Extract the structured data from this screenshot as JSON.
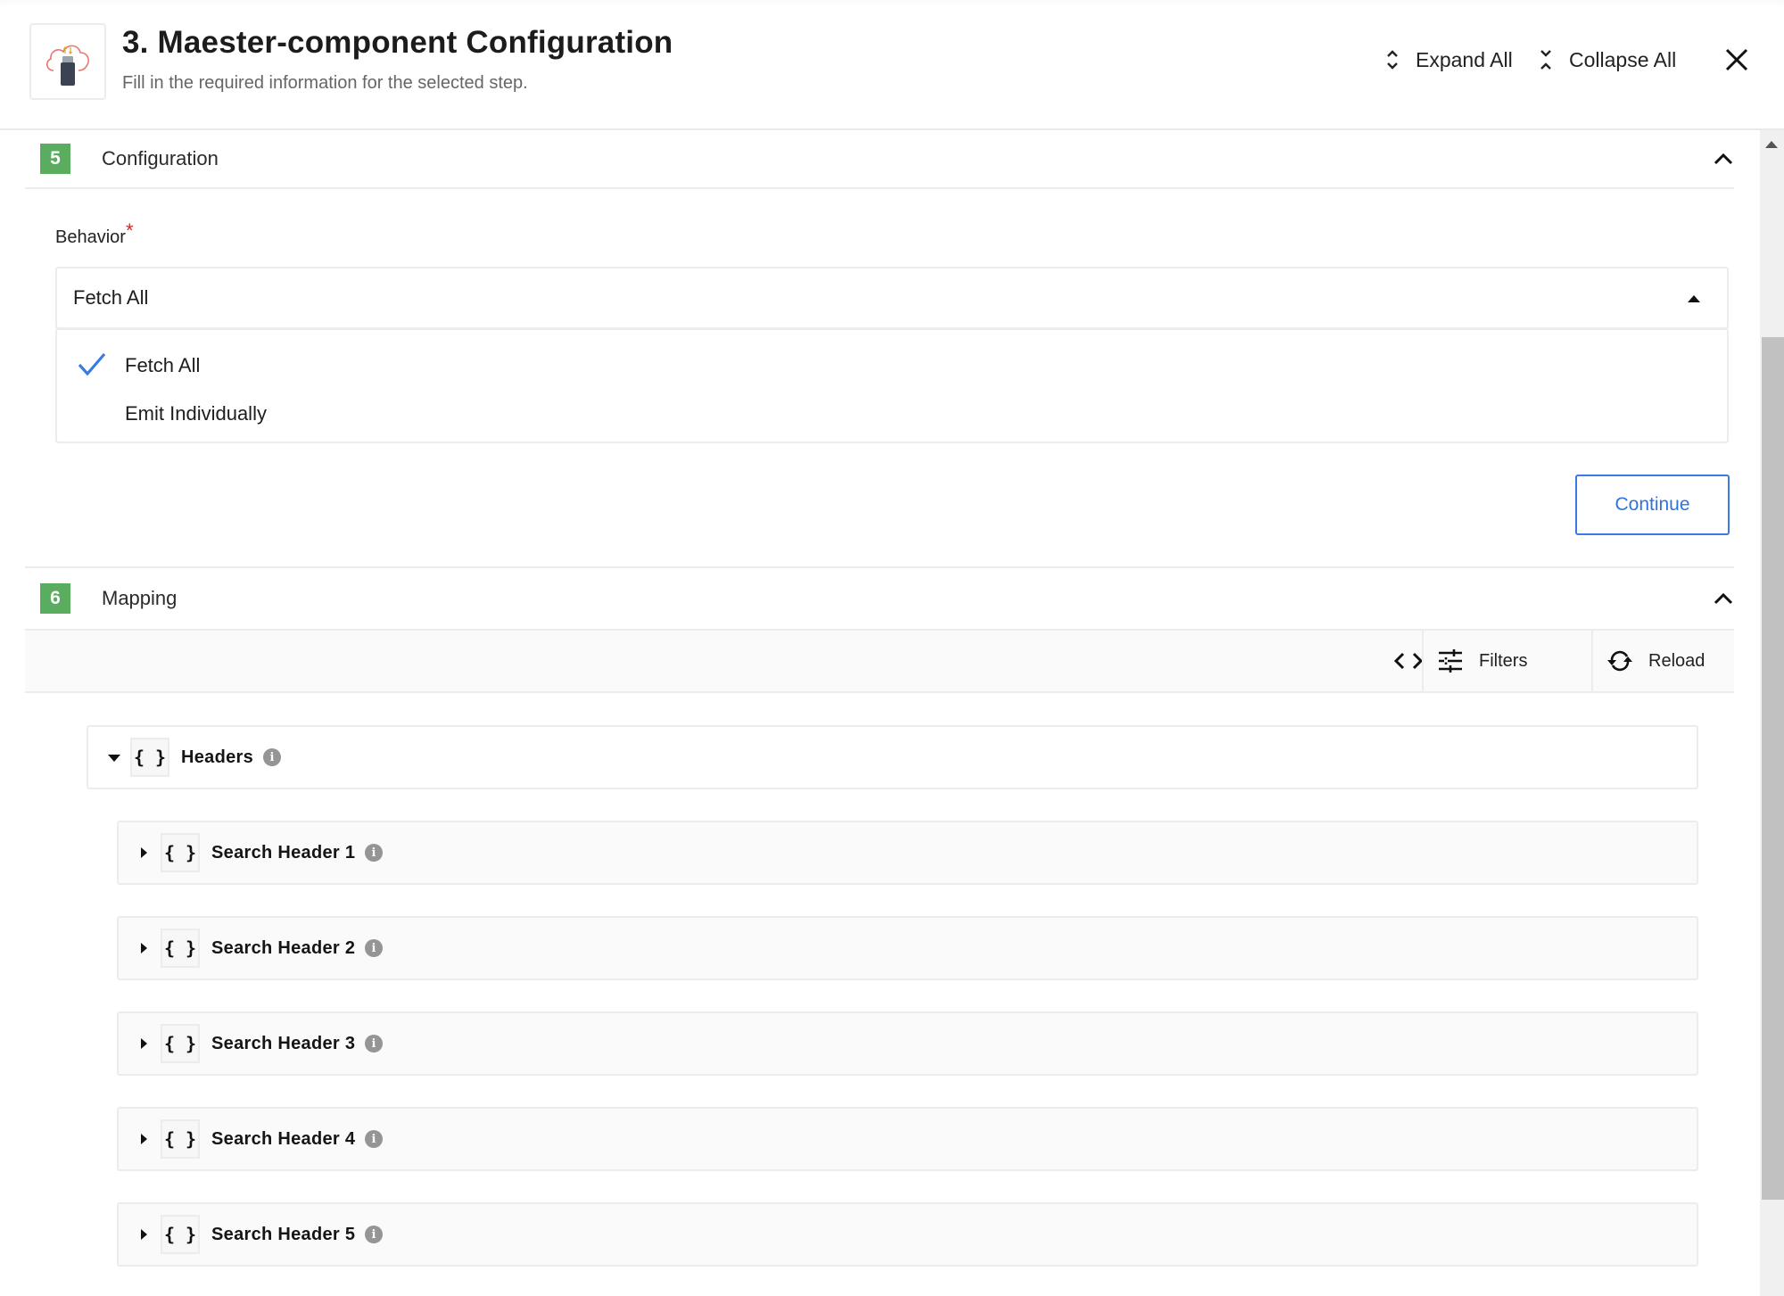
{
  "header": {
    "title": "3. Maester-component Configuration",
    "subtitle": "Fill in the required information for the selected step.",
    "logo_icon": "cloud-usb-icon",
    "expand_all_label": "Expand All",
    "collapse_all_label": "Collapse All",
    "close_icon": "close-icon"
  },
  "sections": [
    {
      "number": "5",
      "title": "Configuration",
      "expanded": true,
      "field": {
        "label": "Behavior",
        "required_mark": "*",
        "selected_value": "Fetch All",
        "dropdown_open": true,
        "options": [
          {
            "label": "Fetch All",
            "selected": true
          },
          {
            "label": "Emit Individually",
            "selected": false
          }
        ]
      },
      "continue_label": "Continue"
    },
    {
      "number": "6",
      "title": "Mapping",
      "expanded": true,
      "toolbar": {
        "code_view_icon": "code-brackets-icon",
        "filters_label": "Filters",
        "reload_label": "Reload"
      },
      "tree": {
        "root": {
          "label": "Headers",
          "type_icon": "{ }",
          "expanded": true
        },
        "children": [
          {
            "label": "Search Header 1",
            "type_icon": "{ }",
            "expanded": false
          },
          {
            "label": "Search Header 2",
            "type_icon": "{ }",
            "expanded": false
          },
          {
            "label": "Search Header 3",
            "type_icon": "{ }",
            "expanded": false
          },
          {
            "label": "Search Header 4",
            "type_icon": "{ }",
            "expanded": false
          },
          {
            "label": "Search Header 5",
            "type_icon": "{ }",
            "expanded": false
          }
        ]
      }
    }
  ],
  "colors": {
    "accent_blue": "#2f73dc",
    "step_badge_green": "#5aad5e",
    "required_red": "#e02020",
    "info_gray": "#959595"
  }
}
